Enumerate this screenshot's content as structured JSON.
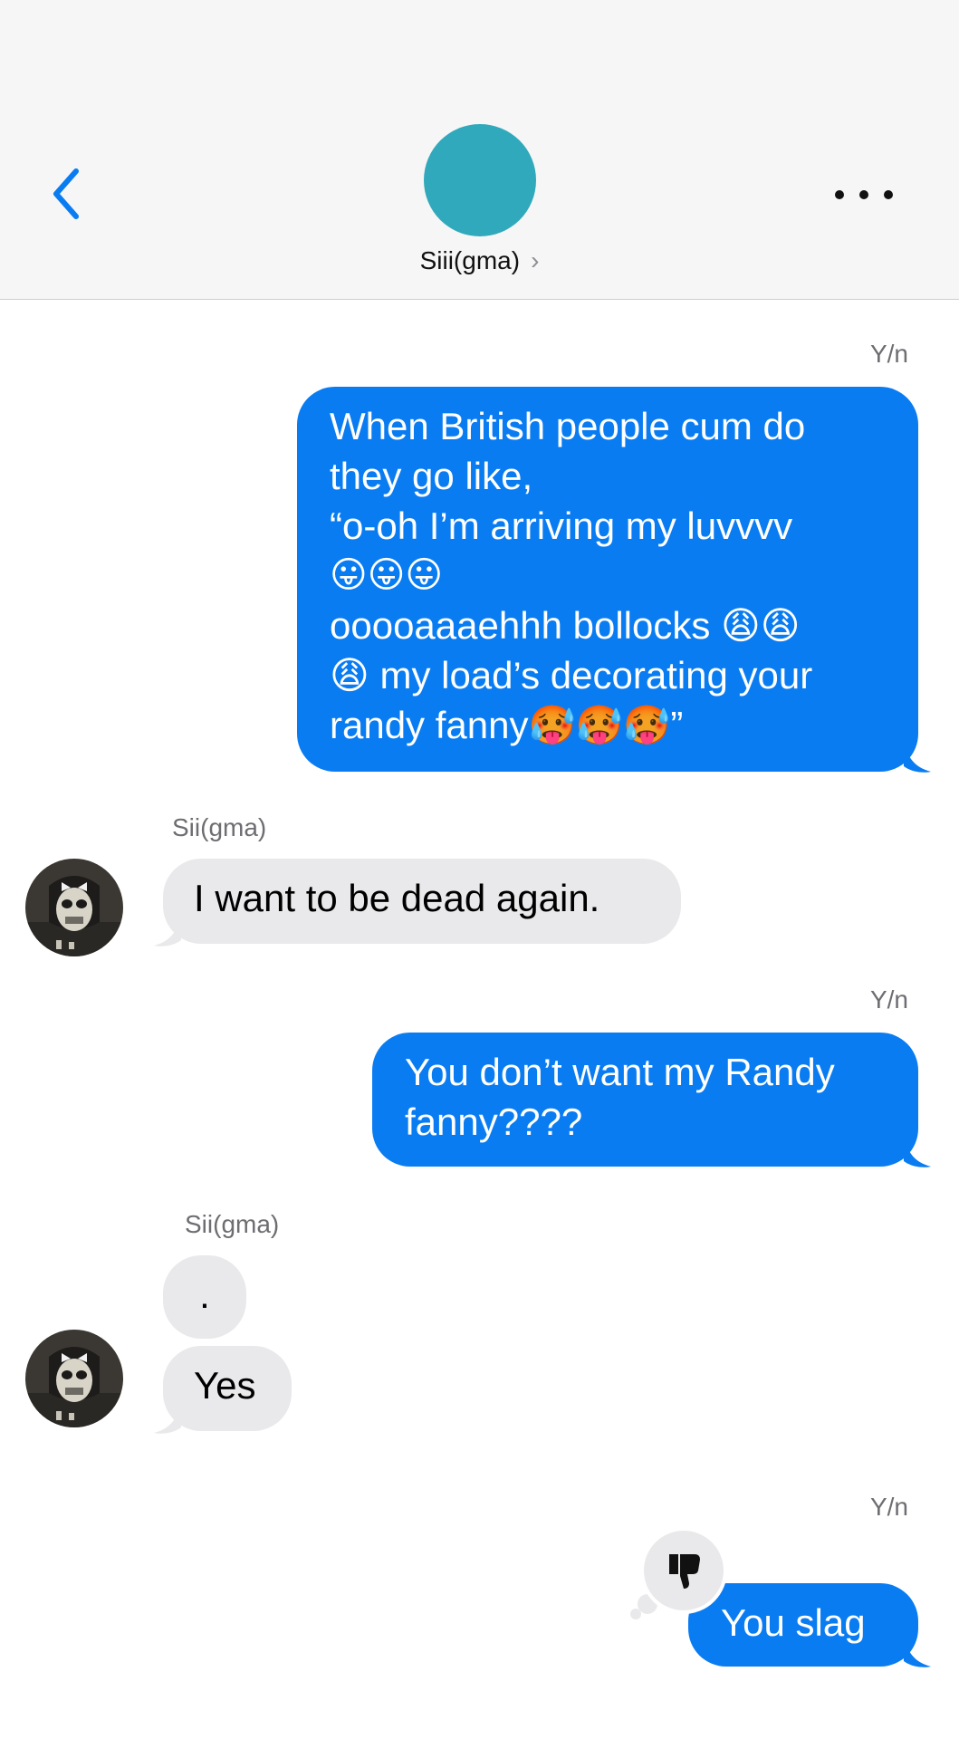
{
  "header": {
    "contact_name": "Siii(gma)",
    "chevron": "›",
    "back_icon": "chevron-left-icon",
    "more_icon": "ellipsis-icon",
    "avatar_color": "#31a9bc"
  },
  "colors": {
    "outgoing_bubble": "#0a7cf2",
    "incoming_bubble": "#e9e9eb",
    "accent": "#0a7cf2"
  },
  "messages": [
    {
      "sender": "Y/n",
      "direction": "outgoing",
      "lines": [
        "When British people cum do",
        "they go like,",
        " “o-oh I’m arriving my luvvvv",
        "😛😛😛",
        "ooooaaaehhh bollocks 😩😩",
        "😩 my load’s decorating your",
        "randy fanny🥵🥵🥵”"
      ]
    },
    {
      "sender": "Sii(gma)",
      "direction": "incoming",
      "text": "I want to be dead again."
    },
    {
      "sender": "Y/n",
      "direction": "outgoing",
      "lines": [
        "You don’t want my Randy",
        "fanny????"
      ]
    },
    {
      "sender": "Sii(gma)",
      "direction": "incoming",
      "text": "."
    },
    {
      "direction": "incoming",
      "text": "Yes"
    },
    {
      "sender": "Y/n",
      "direction": "outgoing",
      "text": "You slag",
      "reaction": "thumbs-down-icon"
    }
  ]
}
